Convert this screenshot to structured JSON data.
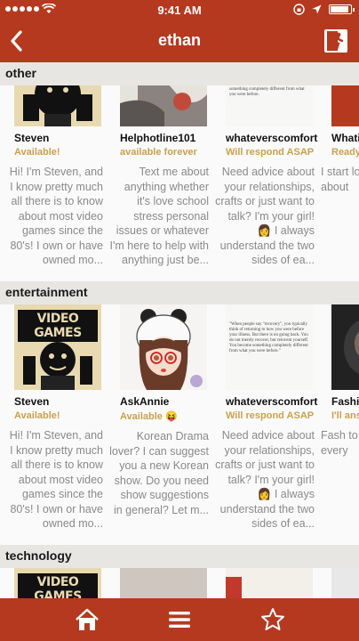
{
  "status_bar": {
    "time": "9:41 AM"
  },
  "nav": {
    "title": "ethan"
  },
  "sections": [
    {
      "title": "other",
      "cards": [
        {
          "name": "Steven",
          "status": "Available!",
          "desc": "Hi! I'm Steven, and I know pretty much all there is to know about most video games since the 80's! I own or have owned mo..."
        },
        {
          "name": "Helphotline101",
          "status": "available forever",
          "desc": "Text me about anything whether it's love school stress personal issues or whatever I'm here to help with anything just be..."
        },
        {
          "name": "whateverscomfort",
          "status": "Will respond ASAP",
          "desc": "Need advice about your relationships, crafts or just want to talk? I'm your girl! 👩 I always understand the two sides of ea..."
        },
        {
          "name": "Whatis",
          "status": "Ready",
          "desc": "I start love m deep about"
        }
      ]
    },
    {
      "title": "entertainment",
      "cards": [
        {
          "name": "Steven",
          "status": "Available!",
          "desc": "Hi! I'm Steven, and I know pretty much all there is to know about most video games since the 80's! I own or have owned mo..."
        },
        {
          "name": "AskAnnie",
          "status": "Available 😝",
          "desc": "Korean Drama lover? I can suggest you a new Korean show. Do you need show suggestions in general? Let m..."
        },
        {
          "name": "whateverscomfort",
          "status": "Will respond ASAP",
          "desc": "Need advice about your relationships, crafts or just want to talk? I'm your girl! 👩 I always understand the two sides of ea..."
        },
        {
          "name": "Fashio",
          "status": "I'll ans",
          "desc": "Fash to ta style, he every"
        }
      ]
    },
    {
      "title": "technology",
      "cards": []
    }
  ],
  "thumb_text": {
    "video_games": "VIDEO GAMES",
    "quote_short": "but reinvent yourself. You become something completely different from what you were before.",
    "quote_long": "\"When people say \"recovery\", you typically think of returning to how you were before your illness. But there is no going back. You do not merely recover, but reinvent yourself. You become something completely different from what you were before.\""
  },
  "colors": {
    "brand": "#b5391f",
    "status_gold": "#c9a14e"
  }
}
